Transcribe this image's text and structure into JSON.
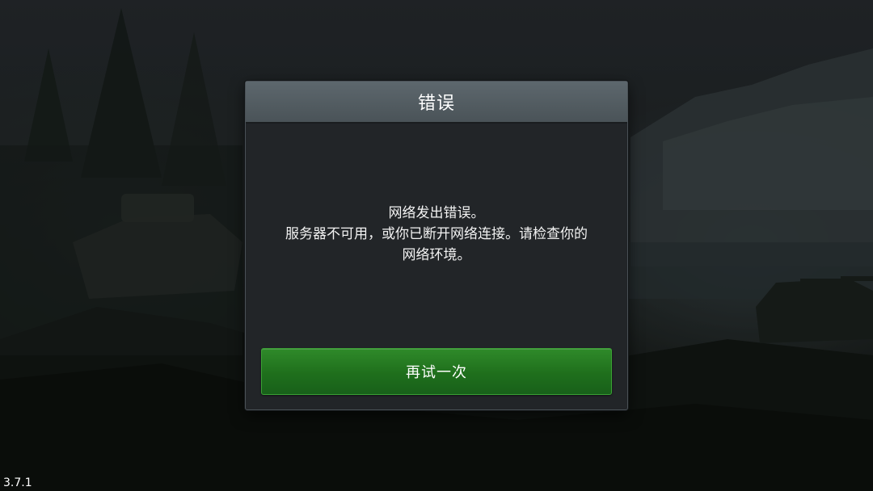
{
  "dialog": {
    "title": "错误",
    "message_lines": [
      "网络发出错误。",
      "服务器不可用，或你已断开网络连接。请检查你的",
      "网络环境。"
    ],
    "retry_label": "再试一次"
  },
  "version": "3.7.1",
  "colors": {
    "retry_button": "#1f6f1c",
    "header": "#525b61",
    "dialog_body": "#222528"
  }
}
